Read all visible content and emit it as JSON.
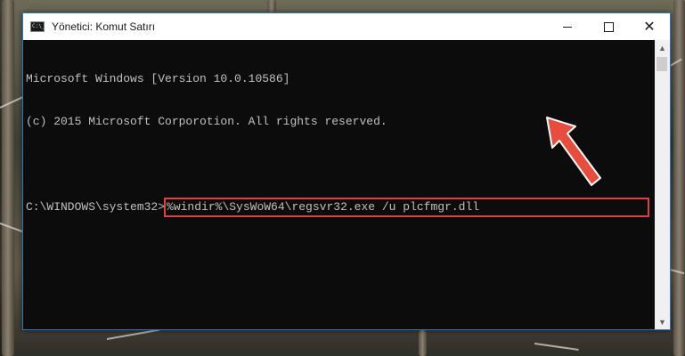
{
  "window": {
    "title": "Yönetici: Komut Satırı",
    "minimize_glyph": "",
    "maximize_glyph": "",
    "close_glyph": "✕"
  },
  "console": {
    "lines": [
      "Microsoft Windows [Version 10.0.10586]",
      "(c) 2015 Microsoft Corporotion. All rights reserved."
    ],
    "prompt": "C:\\WINDOWS\\system32>",
    "command": "%windir%\\SysWoW64\\regsvr32.exe /u plcfmgr.dll"
  },
  "scrollbar": {
    "up_glyph": "▲",
    "down_glyph": "▼"
  },
  "colors": {
    "highlight": "#e04040",
    "arrow": "#e74c3c",
    "console_text": "#c0c0c0",
    "console_bg": "#0c0c0c"
  },
  "icons": {
    "app": "cmd-icon",
    "pointer": "red-arrow-icon"
  }
}
